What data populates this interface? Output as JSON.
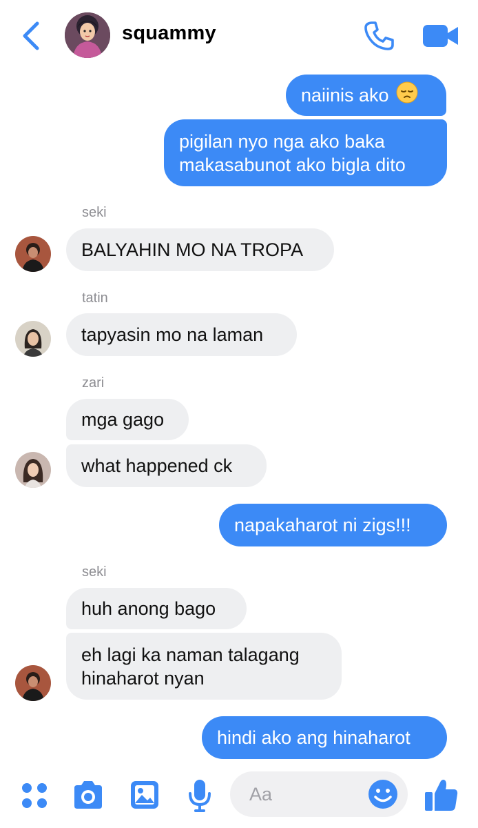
{
  "header": {
    "title": "squammy"
  },
  "colors": {
    "accent": "#3c8af6",
    "outgoing_bubble": "#3c8af6",
    "incoming_bubble": "#eeeff1",
    "sender_label": "#8d8d92"
  },
  "messages": [
    {
      "direction": "outgoing",
      "text": "naiinis ako",
      "emoji": "pensive-face"
    },
    {
      "direction": "outgoing",
      "lines": [
        "pigilan nyo nga ako baka",
        "makasabunot ako bigla dito"
      ]
    },
    {
      "sender": "seki"
    },
    {
      "direction": "incoming",
      "text": "BALYAHIN MO NA TROPA"
    },
    {
      "sender": "tatin"
    },
    {
      "direction": "incoming",
      "text": "tapyasin mo na laman"
    },
    {
      "sender": "zari"
    },
    {
      "direction": "incoming",
      "text": "mga gago"
    },
    {
      "direction": "incoming",
      "text": "what happened ck"
    },
    {
      "direction": "outgoing",
      "text": "napakaharot ni zigs!!!"
    },
    {
      "sender": "seki"
    },
    {
      "direction": "incoming",
      "text": "huh anong bago"
    },
    {
      "direction": "incoming",
      "lines": [
        "eh lagi ka naman talagang",
        "hinaharot nyan"
      ]
    },
    {
      "direction": "outgoing",
      "text": "hindi ako ang hinaharot"
    }
  ],
  "composer": {
    "placeholder": "Aa",
    "icons": [
      "apps-icon",
      "camera-icon",
      "gallery-icon",
      "microphone-icon",
      "emoji-icon",
      "thumbs-up-icon"
    ]
  }
}
